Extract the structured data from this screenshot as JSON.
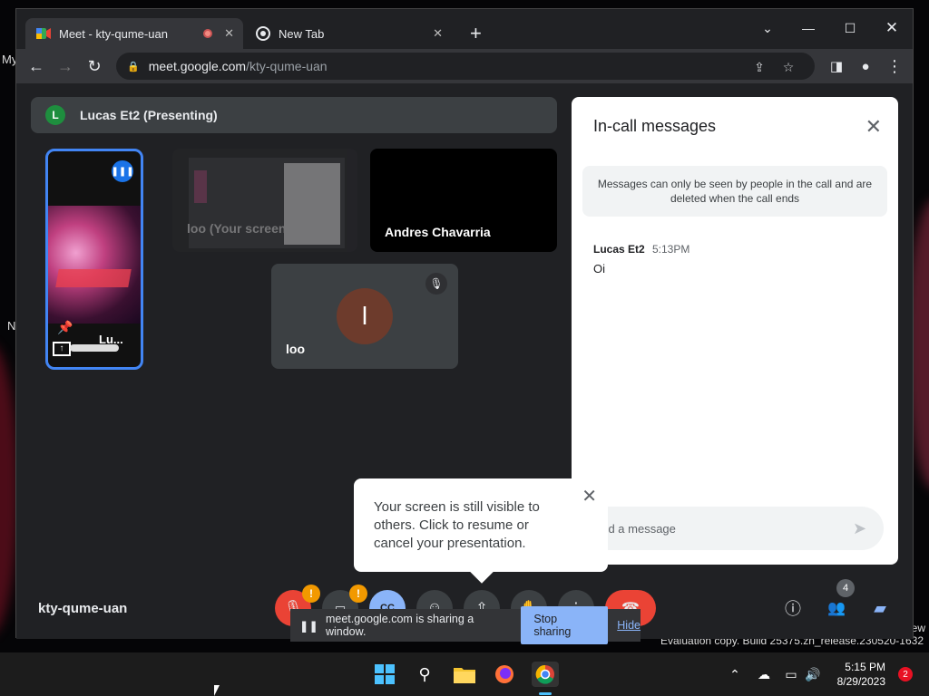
{
  "browser": {
    "tabs": [
      {
        "title": "Meet - kty-qume-uan",
        "active": true,
        "recording": true
      },
      {
        "title": "New Tab",
        "active": false
      }
    ],
    "url_host": "meet.google.com",
    "url_path": "/kty-qume-uan"
  },
  "meet": {
    "presenter_initial": "L",
    "presenting_label": "Lucas Et2 (Presenting)",
    "tiles": [
      {
        "name": "Lu...",
        "kind": "presenting-video"
      },
      {
        "name": "loo (Your screen)",
        "kind": "self-screen"
      },
      {
        "name": "Andres Chavarria",
        "kind": "camera-off"
      },
      {
        "name": "loo",
        "initial": "l",
        "kind": "avatar",
        "muted": true
      }
    ],
    "meeting_code": "kty-qume-uan",
    "warning_mark": "!",
    "participants_count": "4"
  },
  "chat": {
    "title": "In-call messages",
    "notice": "Messages can only be seen by people in the call and are deleted when the call ends",
    "messages": [
      {
        "sender": "Lucas Et2",
        "time": "5:13PM",
        "text": "Oi"
      }
    ],
    "input_placeholder": "end a message"
  },
  "popup": {
    "text": "Your screen is still visible to others. Click to resume or cancel your presentation."
  },
  "sharebar": {
    "text": "meet.google.com is sharing a window.",
    "stop_label": "Stop sharing",
    "hide_label": "Hide"
  },
  "desktop": {
    "label_my": "My",
    "label_n": "N",
    "watermark_new": "ew",
    "watermark": "Evaluation copy. Build 25375.zn_release.230520-1632"
  },
  "taskbar": {
    "time": "5:15 PM",
    "date": "8/29/2023",
    "notification_count": "2"
  },
  "colors": {
    "meet_blue": "#8ab4f8",
    "end_call_red": "#ea4335",
    "warning_orange": "#f29900",
    "selected_tile_border": "#4285f4"
  }
}
